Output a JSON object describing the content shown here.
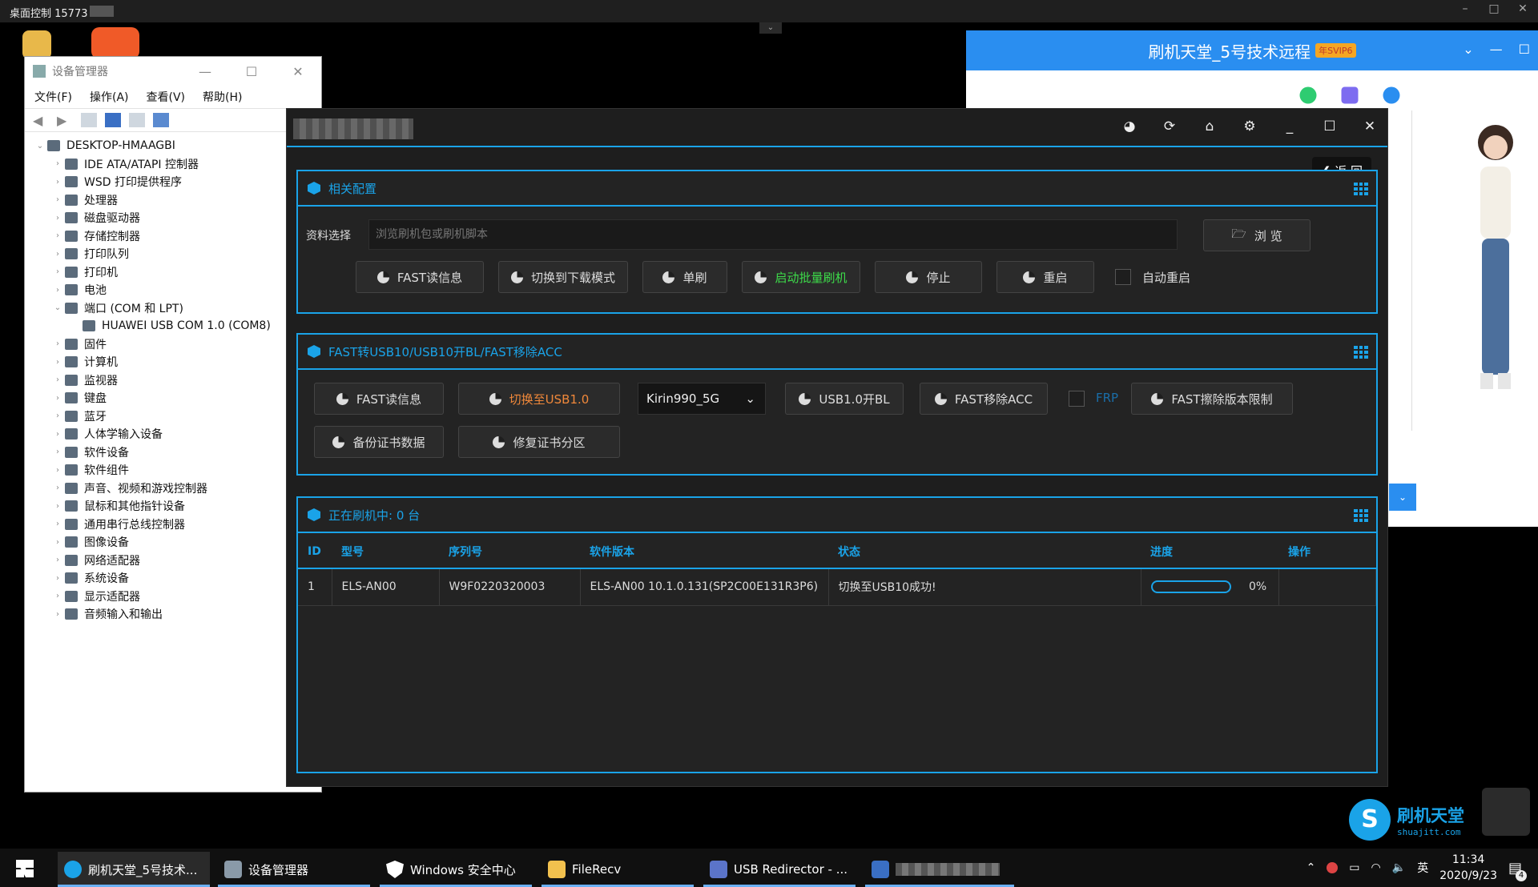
{
  "remote_bar": {
    "title": "桌面控制 15773"
  },
  "devmgr": {
    "title": "设备管理器",
    "menus": [
      "文件(F)",
      "操作(A)",
      "查看(V)",
      "帮助(H)"
    ],
    "tree": [
      {
        "label": "DESKTOP-HMAAGBI",
        "level": 0,
        "chev": "⌄"
      },
      {
        "label": "IDE ATA/ATAPI 控制器",
        "level": 1,
        "chev": "›"
      },
      {
        "label": "WSD 打印提供程序",
        "level": 1,
        "chev": "›"
      },
      {
        "label": "处理器",
        "level": 1,
        "chev": "›"
      },
      {
        "label": "磁盘驱动器",
        "level": 1,
        "chev": "›"
      },
      {
        "label": "存储控制器",
        "level": 1,
        "chev": "›"
      },
      {
        "label": "打印队列",
        "level": 1,
        "chev": "›"
      },
      {
        "label": "打印机",
        "level": 1,
        "chev": "›"
      },
      {
        "label": "电池",
        "level": 1,
        "chev": "›"
      },
      {
        "label": "端口 (COM 和 LPT)",
        "level": 1,
        "chev": "⌄"
      },
      {
        "label": "HUAWEI USB COM 1.0 (COM8)",
        "level": 2,
        "chev": ""
      },
      {
        "label": "固件",
        "level": 1,
        "chev": "›"
      },
      {
        "label": "计算机",
        "level": 1,
        "chev": "›"
      },
      {
        "label": "监视器",
        "level": 1,
        "chev": "›"
      },
      {
        "label": "键盘",
        "level": 1,
        "chev": "›"
      },
      {
        "label": "蓝牙",
        "level": 1,
        "chev": "›"
      },
      {
        "label": "人体学输入设备",
        "level": 1,
        "chev": "›"
      },
      {
        "label": "软件设备",
        "level": 1,
        "chev": "›"
      },
      {
        "label": "软件组件",
        "level": 1,
        "chev": "›"
      },
      {
        "label": "声音、视频和游戏控制器",
        "level": 1,
        "chev": "›"
      },
      {
        "label": "鼠标和其他指针设备",
        "level": 1,
        "chev": "›"
      },
      {
        "label": "通用串行总线控制器",
        "level": 1,
        "chev": "›"
      },
      {
        "label": "图像设备",
        "level": 1,
        "chev": "›"
      },
      {
        "label": "网络适配器",
        "level": 1,
        "chev": "›"
      },
      {
        "label": "系统设备",
        "level": 1,
        "chev": "›"
      },
      {
        "label": "显示适配器",
        "level": 1,
        "chev": "›"
      },
      {
        "label": "音频输入和输出",
        "level": 1,
        "chev": "›"
      }
    ]
  },
  "chat": {
    "title": "刷机天堂_5号技术远程",
    "vip": "年SVIP6"
  },
  "tool": {
    "back": "❮ 返 回",
    "config": {
      "heading": "相关配置",
      "file_label": "资料选择",
      "file_placeholder": "浏览刷机包或刷机脚本",
      "browse": "浏 览",
      "buttons": [
        "FAST读信息",
        "切换到下载模式",
        "单刷",
        "启动批量刷机",
        "停止",
        "重启"
      ],
      "auto_reboot": "自动重启"
    },
    "usb": {
      "heading": "FAST转USB10/USB10开BL/FAST移除ACC",
      "buttons": [
        "FAST读信息",
        "切换至USB1.0",
        "USB1.0开BL",
        "FAST移除ACC",
        "FAST擦除版本限制",
        "备份证书数据",
        "修复证书分区"
      ],
      "chip_select": "Kirin990_5G",
      "frp": "FRP"
    },
    "flashing": {
      "heading": "正在刷机中: 0 台",
      "columns": [
        "ID",
        "型号",
        "序列号",
        "软件版本",
        "状态",
        "进度",
        "操作"
      ],
      "rows": [
        {
          "id": "1",
          "model": "ELS-AN00",
          "serial": "W9F0220320003",
          "version": "ELS-AN00 10.1.0.131(SP2C00E131R3P6)",
          "status": "切换至USB10成功!",
          "progress": "0%"
        }
      ]
    }
  },
  "logo": {
    "name": "刷机天堂",
    "url": "shuajitt.com"
  },
  "taskbar": {
    "tasks": [
      "刷机天堂_5号技术...",
      "设备管理器",
      "Windows 安全中心",
      "FileRecv",
      "USB Redirector - ..."
    ],
    "ime": "英",
    "time": "11:34",
    "date": "2020/9/23",
    "notifications": "4"
  }
}
